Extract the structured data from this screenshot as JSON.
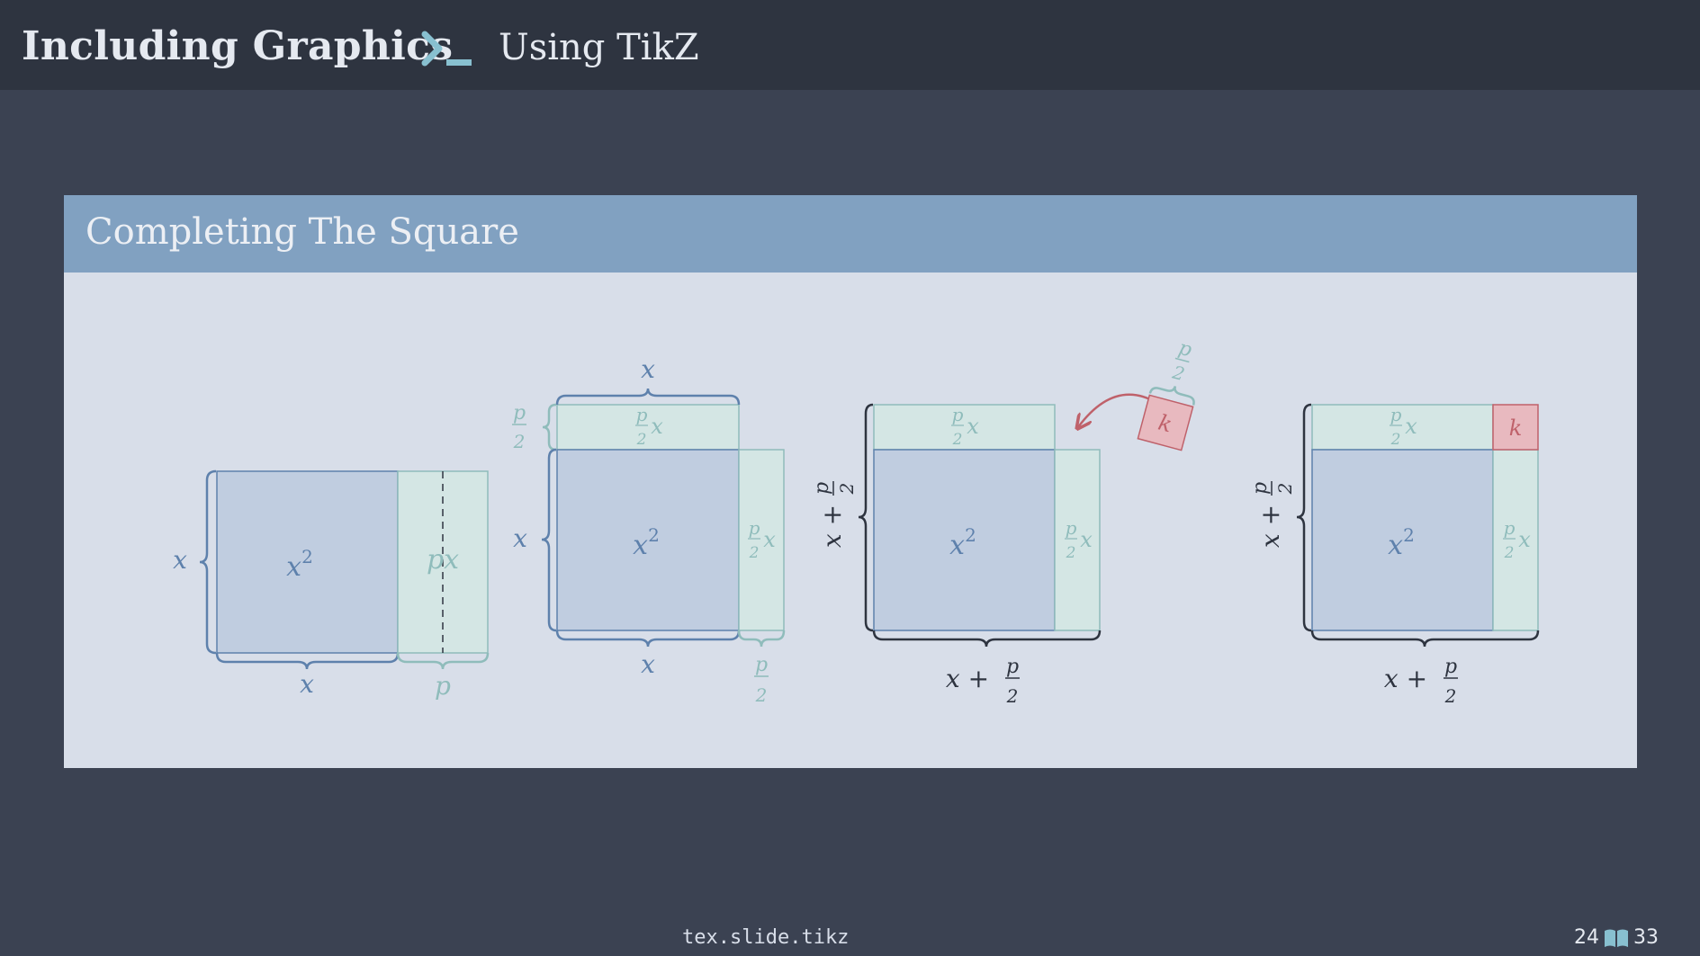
{
  "header": {
    "title": "Including Graphics",
    "subtitle": "Using TikZ"
  },
  "block": {
    "title": "Completing The Square"
  },
  "diagram": {
    "colors": {
      "blue": "#5e81ac",
      "teal": "#8fbcbb",
      "red": "#bf616a",
      "dark": "#2e3440"
    },
    "labels": {
      "x": "x",
      "x2_base": "x",
      "x2_exp": "2",
      "p": "p",
      "px": "px",
      "half_num": "p",
      "half_den": "2",
      "k": "k",
      "x_plus": "x +"
    }
  },
  "footer": {
    "path": "tex.slide.tikz",
    "page": "24",
    "total": "33"
  }
}
